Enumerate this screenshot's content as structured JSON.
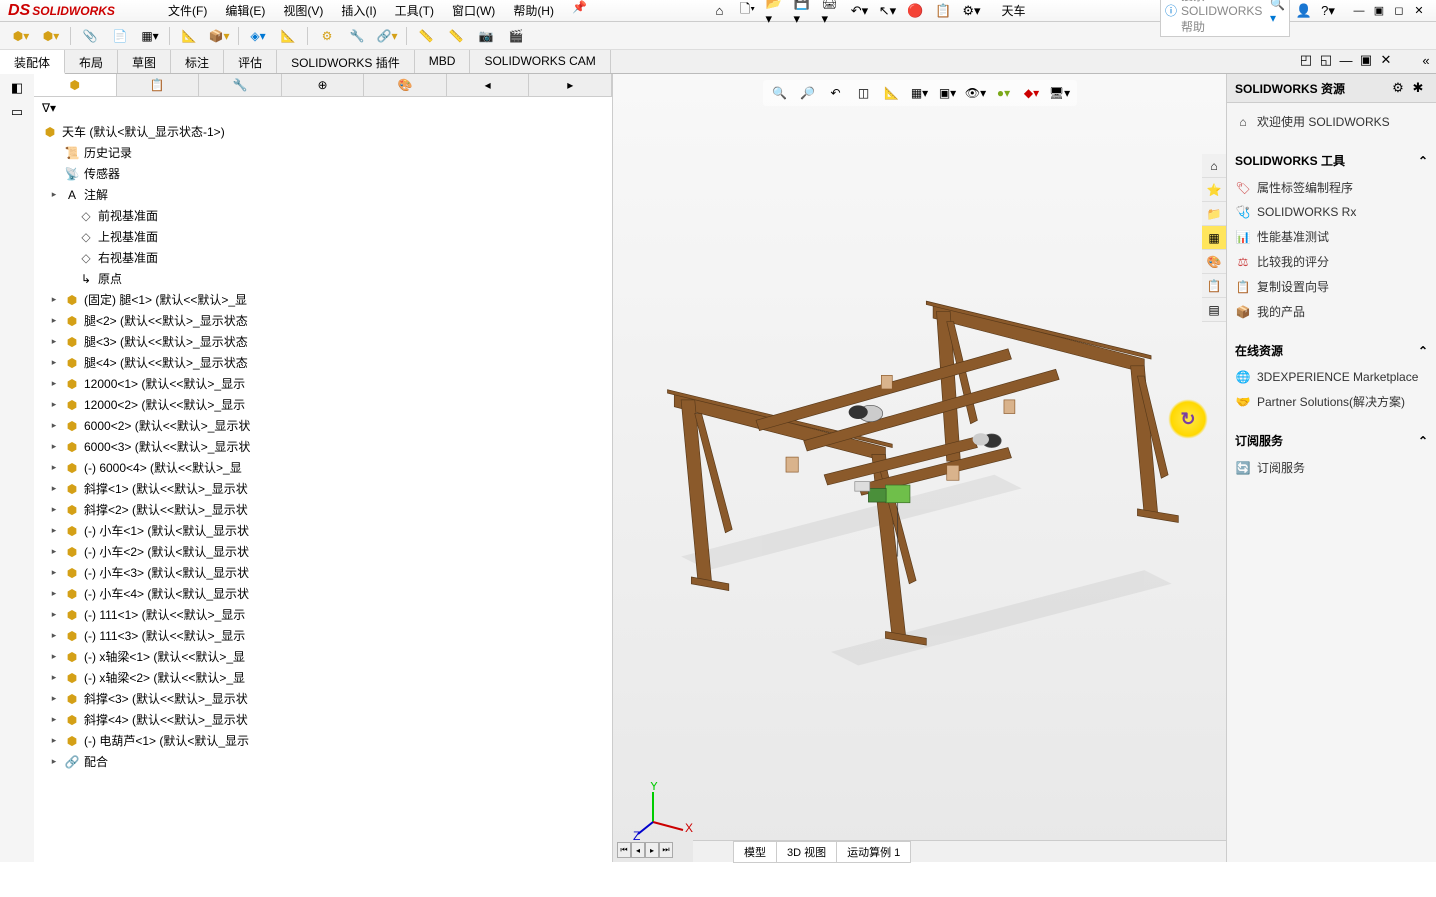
{
  "menu": {
    "file": "文件(F)",
    "edit": "编辑(E)",
    "view": "视图(V)",
    "insert": "插入(I)",
    "tools": "工具(T)",
    "window": "窗口(W)",
    "help": "帮助(H)"
  },
  "logo": "SOLIDWORKS",
  "doc_name": "天车",
  "search_placeholder": "搜索 SOLIDWORKS 帮助",
  "ribbon_tabs": [
    "装配体",
    "布局",
    "草图",
    "标注",
    "评估",
    "SOLIDWORKS 插件",
    "MBD",
    "SOLIDWORKS CAM"
  ],
  "tree": {
    "root": "天车  (默认<默认_显示状态-1>)",
    "items": [
      {
        "icon": "history",
        "label": "历史记录",
        "indent": 1
      },
      {
        "icon": "sensor",
        "label": "传感器",
        "indent": 1
      },
      {
        "icon": "note",
        "label": "注解",
        "indent": 1,
        "expand": "▸"
      },
      {
        "icon": "plane",
        "label": "前视基准面",
        "indent": 2
      },
      {
        "icon": "plane",
        "label": "上视基准面",
        "indent": 2
      },
      {
        "icon": "plane",
        "label": "右视基准面",
        "indent": 2
      },
      {
        "icon": "origin",
        "label": "原点",
        "indent": 2
      },
      {
        "icon": "part",
        "label": "(固定) 腿<1> (默认<<默认>_显",
        "indent": 1,
        "expand": "▸"
      },
      {
        "icon": "part",
        "label": "腿<2> (默认<<默认>_显示状态",
        "indent": 1,
        "expand": "▸"
      },
      {
        "icon": "part",
        "label": "腿<3> (默认<<默认>_显示状态",
        "indent": 1,
        "expand": "▸"
      },
      {
        "icon": "part",
        "label": "腿<4> (默认<<默认>_显示状态",
        "indent": 1,
        "expand": "▸"
      },
      {
        "icon": "part",
        "label": "12000<1> (默认<<默认>_显示",
        "indent": 1,
        "expand": "▸"
      },
      {
        "icon": "part",
        "label": "12000<2> (默认<<默认>_显示",
        "indent": 1,
        "expand": "▸"
      },
      {
        "icon": "part",
        "label": "6000<2> (默认<<默认>_显示状",
        "indent": 1,
        "expand": "▸"
      },
      {
        "icon": "part",
        "label": "6000<3> (默认<<默认>_显示状",
        "indent": 1,
        "expand": "▸"
      },
      {
        "icon": "part",
        "label": "(-) 6000<4> (默认<<默认>_显",
        "indent": 1,
        "expand": "▸"
      },
      {
        "icon": "part",
        "label": "斜撑<1> (默认<<默认>_显示状",
        "indent": 1,
        "expand": "▸"
      },
      {
        "icon": "part",
        "label": "斜撑<2> (默认<<默认>_显示状",
        "indent": 1,
        "expand": "▸"
      },
      {
        "icon": "part",
        "label": "(-) 小车<1> (默认<默认_显示状",
        "indent": 1,
        "expand": "▸"
      },
      {
        "icon": "part",
        "label": "(-) 小车<2> (默认<默认_显示状",
        "indent": 1,
        "expand": "▸"
      },
      {
        "icon": "part",
        "label": "(-) 小车<3> (默认<默认_显示状",
        "indent": 1,
        "expand": "▸"
      },
      {
        "icon": "part",
        "label": "(-) 小车<4> (默认<默认_显示状",
        "indent": 1,
        "expand": "▸"
      },
      {
        "icon": "part",
        "label": "(-) 111<1> (默认<<默认>_显示",
        "indent": 1,
        "expand": "▸"
      },
      {
        "icon": "part",
        "label": "(-) 111<3> (默认<<默认>_显示",
        "indent": 1,
        "expand": "▸"
      },
      {
        "icon": "part",
        "label": "(-) x轴梁<1> (默认<<默认>_显",
        "indent": 1,
        "expand": "▸"
      },
      {
        "icon": "part",
        "label": "(-) x轴梁<2> (默认<<默认>_显",
        "indent": 1,
        "expand": "▸"
      },
      {
        "icon": "part",
        "label": "斜撑<3> (默认<<默认>_显示状",
        "indent": 1,
        "expand": "▸"
      },
      {
        "icon": "part",
        "label": "斜撑<4> (默认<<默认>_显示状",
        "indent": 1,
        "expand": "▸"
      },
      {
        "icon": "part",
        "label": "(-) 电葫芦<1> (默认<默认_显示",
        "indent": 1,
        "expand": "▸"
      },
      {
        "icon": "mates",
        "label": "配合",
        "indent": 1,
        "expand": "▸"
      }
    ]
  },
  "right_panel": {
    "title": "SOLIDWORKS 资源",
    "welcome": "欢迎使用  SOLIDWORKS",
    "tools_title": "SOLIDWORKS 工具",
    "tools": [
      "属性标签编制程序",
      "SOLIDWORKS Rx",
      "性能基准测试",
      "比较我的评分",
      "复制设置向导",
      "我的产品"
    ],
    "online_title": "在线资源",
    "online": [
      "3DEXPERIENCE Marketplace",
      "Partner Solutions(解决方案)"
    ],
    "sub_title": "订阅服务",
    "sub": [
      "订阅服务"
    ]
  },
  "bottom_tabs": [
    "模型",
    "3D 视图",
    "运动算例 1"
  ]
}
